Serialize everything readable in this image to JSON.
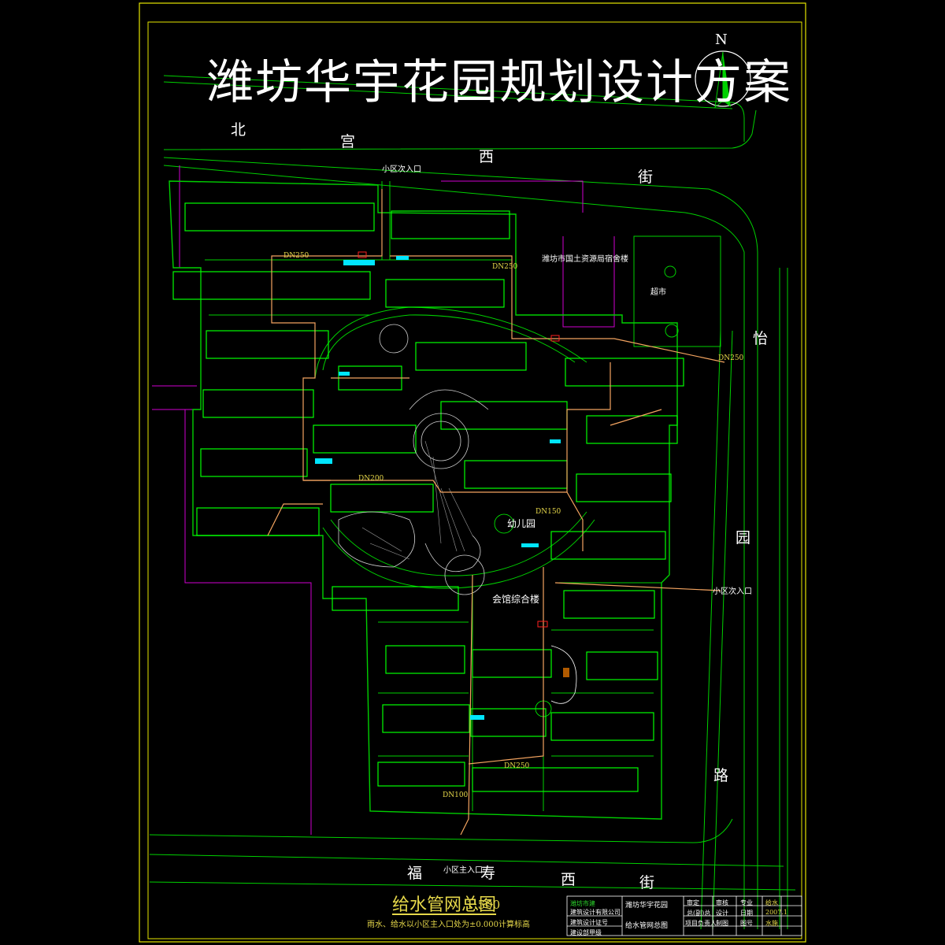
{
  "title": "潍坊华宇花园规划设计方案",
  "north": "N",
  "streets": {
    "north": [
      "北",
      "宫",
      "西",
      "街"
    ],
    "east": [
      "怡",
      "园",
      "路"
    ],
    "south": [
      "福",
      "寿",
      "西",
      "街"
    ]
  },
  "labels": {
    "kindergarten": "幼儿园",
    "clubhouse": "会馆综合楼",
    "supermarket": "超市",
    "main_entrance": "小区主入口",
    "entrance_east": "小区次入口",
    "entrance_north": "小区次入口",
    "existing": "潍坊市国土资源局宿舍楼",
    "pipe_dn250": "DN250",
    "pipe_dn200": "DN200",
    "pipe_dn150": "DN150",
    "pipe_dn100": "DN100"
  },
  "drawing": {
    "name": "给水管网总图",
    "scale": "1:500",
    "note": "雨水、给水以小区主入口处为±0.000计算标高"
  },
  "title_block": {
    "company_line1": "潍坊市建",
    "company_line2": "建筑设计有限公司",
    "project_label": "潍坊华宇花园",
    "drawing_label": "给水管网总图",
    "cert1": "建筑设计证号",
    "cert2": "建设部甲级",
    "cells": [
      "审定",
      "审核",
      "专业",
      "给水",
      "总(副)总",
      "设计",
      "日期",
      "2007.1",
      "项目负责人",
      "制图",
      "图号",
      "水施"
    ]
  },
  "colors": {
    "boundary": "#ffff00",
    "building": "#00ff00",
    "pipe": "#f4a460",
    "road": "#00d000",
    "magenta": "#d000d0",
    "cyan": "#00e5ff"
  }
}
